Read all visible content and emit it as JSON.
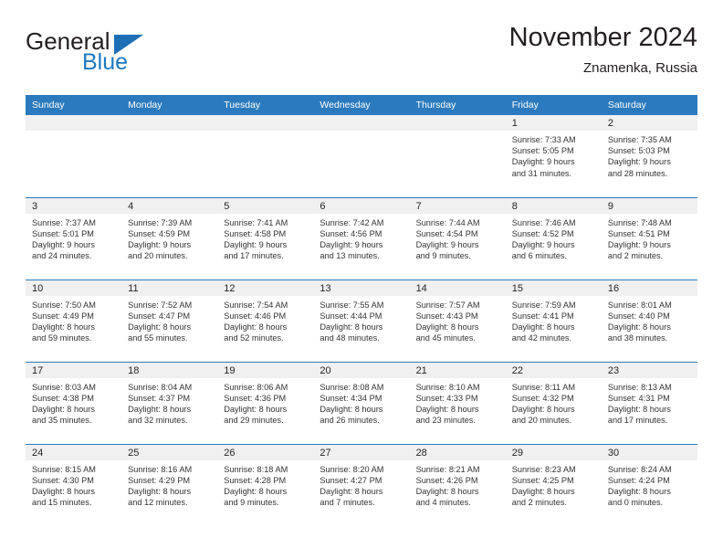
{
  "brand": {
    "name_part1": "General",
    "name_part2": "Blue",
    "triangle_color": "#1c6fb5"
  },
  "header": {
    "title": "November 2024",
    "subtitle": "Znamenka, Russia",
    "accent_color": "#2b7abd"
  },
  "weekday_headers": [
    "Sunday",
    "Monday",
    "Tuesday",
    "Wednesday",
    "Thursday",
    "Friday",
    "Saturday"
  ],
  "days": [
    {
      "date": "",
      "sunrise": "",
      "sunset": "",
      "daylight_line1": "",
      "daylight_line2": "",
      "empty": true
    },
    {
      "date": "",
      "sunrise": "",
      "sunset": "",
      "daylight_line1": "",
      "daylight_line2": "",
      "empty": true
    },
    {
      "date": "",
      "sunrise": "",
      "sunset": "",
      "daylight_line1": "",
      "daylight_line2": "",
      "empty": true
    },
    {
      "date": "",
      "sunrise": "",
      "sunset": "",
      "daylight_line1": "",
      "daylight_line2": "",
      "empty": true
    },
    {
      "date": "",
      "sunrise": "",
      "sunset": "",
      "daylight_line1": "",
      "daylight_line2": "",
      "empty": true
    },
    {
      "date": "1",
      "sunrise": "Sunrise: 7:33 AM",
      "sunset": "Sunset: 5:05 PM",
      "daylight_line1": "Daylight: 9 hours",
      "daylight_line2": "and 31 minutes."
    },
    {
      "date": "2",
      "sunrise": "Sunrise: 7:35 AM",
      "sunset": "Sunset: 5:03 PM",
      "daylight_line1": "Daylight: 9 hours",
      "daylight_line2": "and 28 minutes."
    },
    {
      "date": "3",
      "sunrise": "Sunrise: 7:37 AM",
      "sunset": "Sunset: 5:01 PM",
      "daylight_line1": "Daylight: 9 hours",
      "daylight_line2": "and 24 minutes."
    },
    {
      "date": "4",
      "sunrise": "Sunrise: 7:39 AM",
      "sunset": "Sunset: 4:59 PM",
      "daylight_line1": "Daylight: 9 hours",
      "daylight_line2": "and 20 minutes."
    },
    {
      "date": "5",
      "sunrise": "Sunrise: 7:41 AM",
      "sunset": "Sunset: 4:58 PM",
      "daylight_line1": "Daylight: 9 hours",
      "daylight_line2": "and 17 minutes."
    },
    {
      "date": "6",
      "sunrise": "Sunrise: 7:42 AM",
      "sunset": "Sunset: 4:56 PM",
      "daylight_line1": "Daylight: 9 hours",
      "daylight_line2": "and 13 minutes."
    },
    {
      "date": "7",
      "sunrise": "Sunrise: 7:44 AM",
      "sunset": "Sunset: 4:54 PM",
      "daylight_line1": "Daylight: 9 hours",
      "daylight_line2": "and 9 minutes."
    },
    {
      "date": "8",
      "sunrise": "Sunrise: 7:46 AM",
      "sunset": "Sunset: 4:52 PM",
      "daylight_line1": "Daylight: 9 hours",
      "daylight_line2": "and 6 minutes."
    },
    {
      "date": "9",
      "sunrise": "Sunrise: 7:48 AM",
      "sunset": "Sunset: 4:51 PM",
      "daylight_line1": "Daylight: 9 hours",
      "daylight_line2": "and 2 minutes."
    },
    {
      "date": "10",
      "sunrise": "Sunrise: 7:50 AM",
      "sunset": "Sunset: 4:49 PM",
      "daylight_line1": "Daylight: 8 hours",
      "daylight_line2": "and 59 minutes."
    },
    {
      "date": "11",
      "sunrise": "Sunrise: 7:52 AM",
      "sunset": "Sunset: 4:47 PM",
      "daylight_line1": "Daylight: 8 hours",
      "daylight_line2": "and 55 minutes."
    },
    {
      "date": "12",
      "sunrise": "Sunrise: 7:54 AM",
      "sunset": "Sunset: 4:46 PM",
      "daylight_line1": "Daylight: 8 hours",
      "daylight_line2": "and 52 minutes."
    },
    {
      "date": "13",
      "sunrise": "Sunrise: 7:55 AM",
      "sunset": "Sunset: 4:44 PM",
      "daylight_line1": "Daylight: 8 hours",
      "daylight_line2": "and 48 minutes."
    },
    {
      "date": "14",
      "sunrise": "Sunrise: 7:57 AM",
      "sunset": "Sunset: 4:43 PM",
      "daylight_line1": "Daylight: 8 hours",
      "daylight_line2": "and 45 minutes."
    },
    {
      "date": "15",
      "sunrise": "Sunrise: 7:59 AM",
      "sunset": "Sunset: 4:41 PM",
      "daylight_line1": "Daylight: 8 hours",
      "daylight_line2": "and 42 minutes."
    },
    {
      "date": "16",
      "sunrise": "Sunrise: 8:01 AM",
      "sunset": "Sunset: 4:40 PM",
      "daylight_line1": "Daylight: 8 hours",
      "daylight_line2": "and 38 minutes."
    },
    {
      "date": "17",
      "sunrise": "Sunrise: 8:03 AM",
      "sunset": "Sunset: 4:38 PM",
      "daylight_line1": "Daylight: 8 hours",
      "daylight_line2": "and 35 minutes."
    },
    {
      "date": "18",
      "sunrise": "Sunrise: 8:04 AM",
      "sunset": "Sunset: 4:37 PM",
      "daylight_line1": "Daylight: 8 hours",
      "daylight_line2": "and 32 minutes."
    },
    {
      "date": "19",
      "sunrise": "Sunrise: 8:06 AM",
      "sunset": "Sunset: 4:36 PM",
      "daylight_line1": "Daylight: 8 hours",
      "daylight_line2": "and 29 minutes."
    },
    {
      "date": "20",
      "sunrise": "Sunrise: 8:08 AM",
      "sunset": "Sunset: 4:34 PM",
      "daylight_line1": "Daylight: 8 hours",
      "daylight_line2": "and 26 minutes."
    },
    {
      "date": "21",
      "sunrise": "Sunrise: 8:10 AM",
      "sunset": "Sunset: 4:33 PM",
      "daylight_line1": "Daylight: 8 hours",
      "daylight_line2": "and 23 minutes."
    },
    {
      "date": "22",
      "sunrise": "Sunrise: 8:11 AM",
      "sunset": "Sunset: 4:32 PM",
      "daylight_line1": "Daylight: 8 hours",
      "daylight_line2": "and 20 minutes."
    },
    {
      "date": "23",
      "sunrise": "Sunrise: 8:13 AM",
      "sunset": "Sunset: 4:31 PM",
      "daylight_line1": "Daylight: 8 hours",
      "daylight_line2": "and 17 minutes."
    },
    {
      "date": "24",
      "sunrise": "Sunrise: 8:15 AM",
      "sunset": "Sunset: 4:30 PM",
      "daylight_line1": "Daylight: 8 hours",
      "daylight_line2": "and 15 minutes."
    },
    {
      "date": "25",
      "sunrise": "Sunrise: 8:16 AM",
      "sunset": "Sunset: 4:29 PM",
      "daylight_line1": "Daylight: 8 hours",
      "daylight_line2": "and 12 minutes."
    },
    {
      "date": "26",
      "sunrise": "Sunrise: 8:18 AM",
      "sunset": "Sunset: 4:28 PM",
      "daylight_line1": "Daylight: 8 hours",
      "daylight_line2": "and 9 minutes."
    },
    {
      "date": "27",
      "sunrise": "Sunrise: 8:20 AM",
      "sunset": "Sunset: 4:27 PM",
      "daylight_line1": "Daylight: 8 hours",
      "daylight_line2": "and 7 minutes."
    },
    {
      "date": "28",
      "sunrise": "Sunrise: 8:21 AM",
      "sunset": "Sunset: 4:26 PM",
      "daylight_line1": "Daylight: 8 hours",
      "daylight_line2": "and 4 minutes."
    },
    {
      "date": "29",
      "sunrise": "Sunrise: 8:23 AM",
      "sunset": "Sunset: 4:25 PM",
      "daylight_line1": "Daylight: 8 hours",
      "daylight_line2": "and 2 minutes."
    },
    {
      "date": "30",
      "sunrise": "Sunrise: 8:24 AM",
      "sunset": "Sunset: 4:24 PM",
      "daylight_line1": "Daylight: 8 hours",
      "daylight_line2": "and 0 minutes."
    }
  ]
}
